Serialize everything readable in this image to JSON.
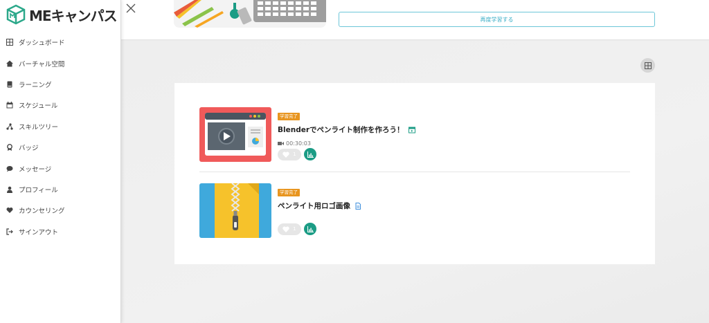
{
  "app": {
    "logo_text": "MEキャンパス"
  },
  "sidebar": {
    "items": [
      {
        "label": "ダッシュボード",
        "icon": "dashboard-grid-icon"
      },
      {
        "label": "バーチャル空間",
        "icon": "house-icon"
      },
      {
        "label": "ラーニング",
        "icon": "book-icon"
      },
      {
        "label": "スケジュール",
        "icon": "calendar-icon"
      },
      {
        "label": "スキルツリー",
        "icon": "skill-tree-icon"
      },
      {
        "label": "バッジ",
        "icon": "badge-icon"
      },
      {
        "label": "メッセージ",
        "icon": "message-bubble-icon"
      },
      {
        "label": "プロフィール",
        "icon": "user-icon"
      },
      {
        "label": "カウンセリング",
        "icon": "heart-icon"
      },
      {
        "label": "サインアウト",
        "icon": "sign-out-icon"
      }
    ]
  },
  "header": {
    "relearn_label": "再度学習する"
  },
  "courses": [
    {
      "badge": "学習完了",
      "title": "Blenderでペンライト制作を作ろう！",
      "title_icon": "video-lesson-icon",
      "duration": "00:30:03",
      "likes": "1",
      "thumbnail": "video-player-thumbnail"
    },
    {
      "badge": "学習完了",
      "title": "ペンライト用ロゴ画像",
      "title_icon": "file-icon",
      "likes": "1",
      "thumbnail": "zip-file-thumbnail"
    }
  ],
  "colors": {
    "accent_teal": "#1b9c85",
    "badge_orange": "#e8951f",
    "button_border": "#6cc6d8",
    "thumb_red": "#f05a5a",
    "thumb_blue": "#3fa9dc",
    "thumb_yellow": "#f6c22b"
  }
}
